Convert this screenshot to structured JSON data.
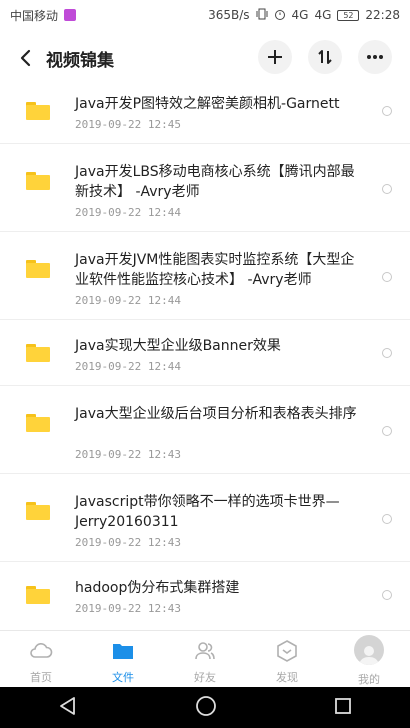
{
  "status_bar": {
    "carrier": "中国移动",
    "net_speed": "365B/s",
    "network_1": "4G",
    "network_2": "4G",
    "battery": "52",
    "time": "22:28"
  },
  "header": {
    "title": "视频锦集"
  },
  "files": [
    {
      "name": "Java开发P图特效之解密美颜相机-Garnett",
      "date": "2019-09-22  12:45"
    },
    {
      "name": "Java开发LBS移动电商核心系统【腾讯内部最新技术】 -Avry老师",
      "date": "2019-09-22  12:44"
    },
    {
      "name": "Java开发JVM性能图表实时监控系统【大型企业软件性能监控核心技术】 -Avry老师",
      "date": "2019-09-22  12:44"
    },
    {
      "name": "Java实现大型企业级Banner效果",
      "date": "2019-09-22  12:44"
    },
    {
      "name": "Java大型企业级后台项目分析和表格表头排序",
      "date": "2019-09-22  12:43"
    },
    {
      "name": "Javascript带你领略不一样的选项卡世界—Jerry20160311",
      "date": "2019-09-22  12:43"
    },
    {
      "name": "hadoop伪分布式集群搭建",
      "date": "2019-09-22  12:43"
    }
  ],
  "tabs": [
    {
      "label": "首页",
      "icon": "cloud-icon"
    },
    {
      "label": "文件",
      "icon": "folder-icon"
    },
    {
      "label": "好友",
      "icon": "friends-icon"
    },
    {
      "label": "发现",
      "icon": "discover-icon"
    },
    {
      "label": "我的",
      "icon": "avatar"
    }
  ],
  "colors": {
    "accent": "#1c8fe8",
    "folder": "#ffd33a",
    "status_badge": "#c04bd8"
  }
}
